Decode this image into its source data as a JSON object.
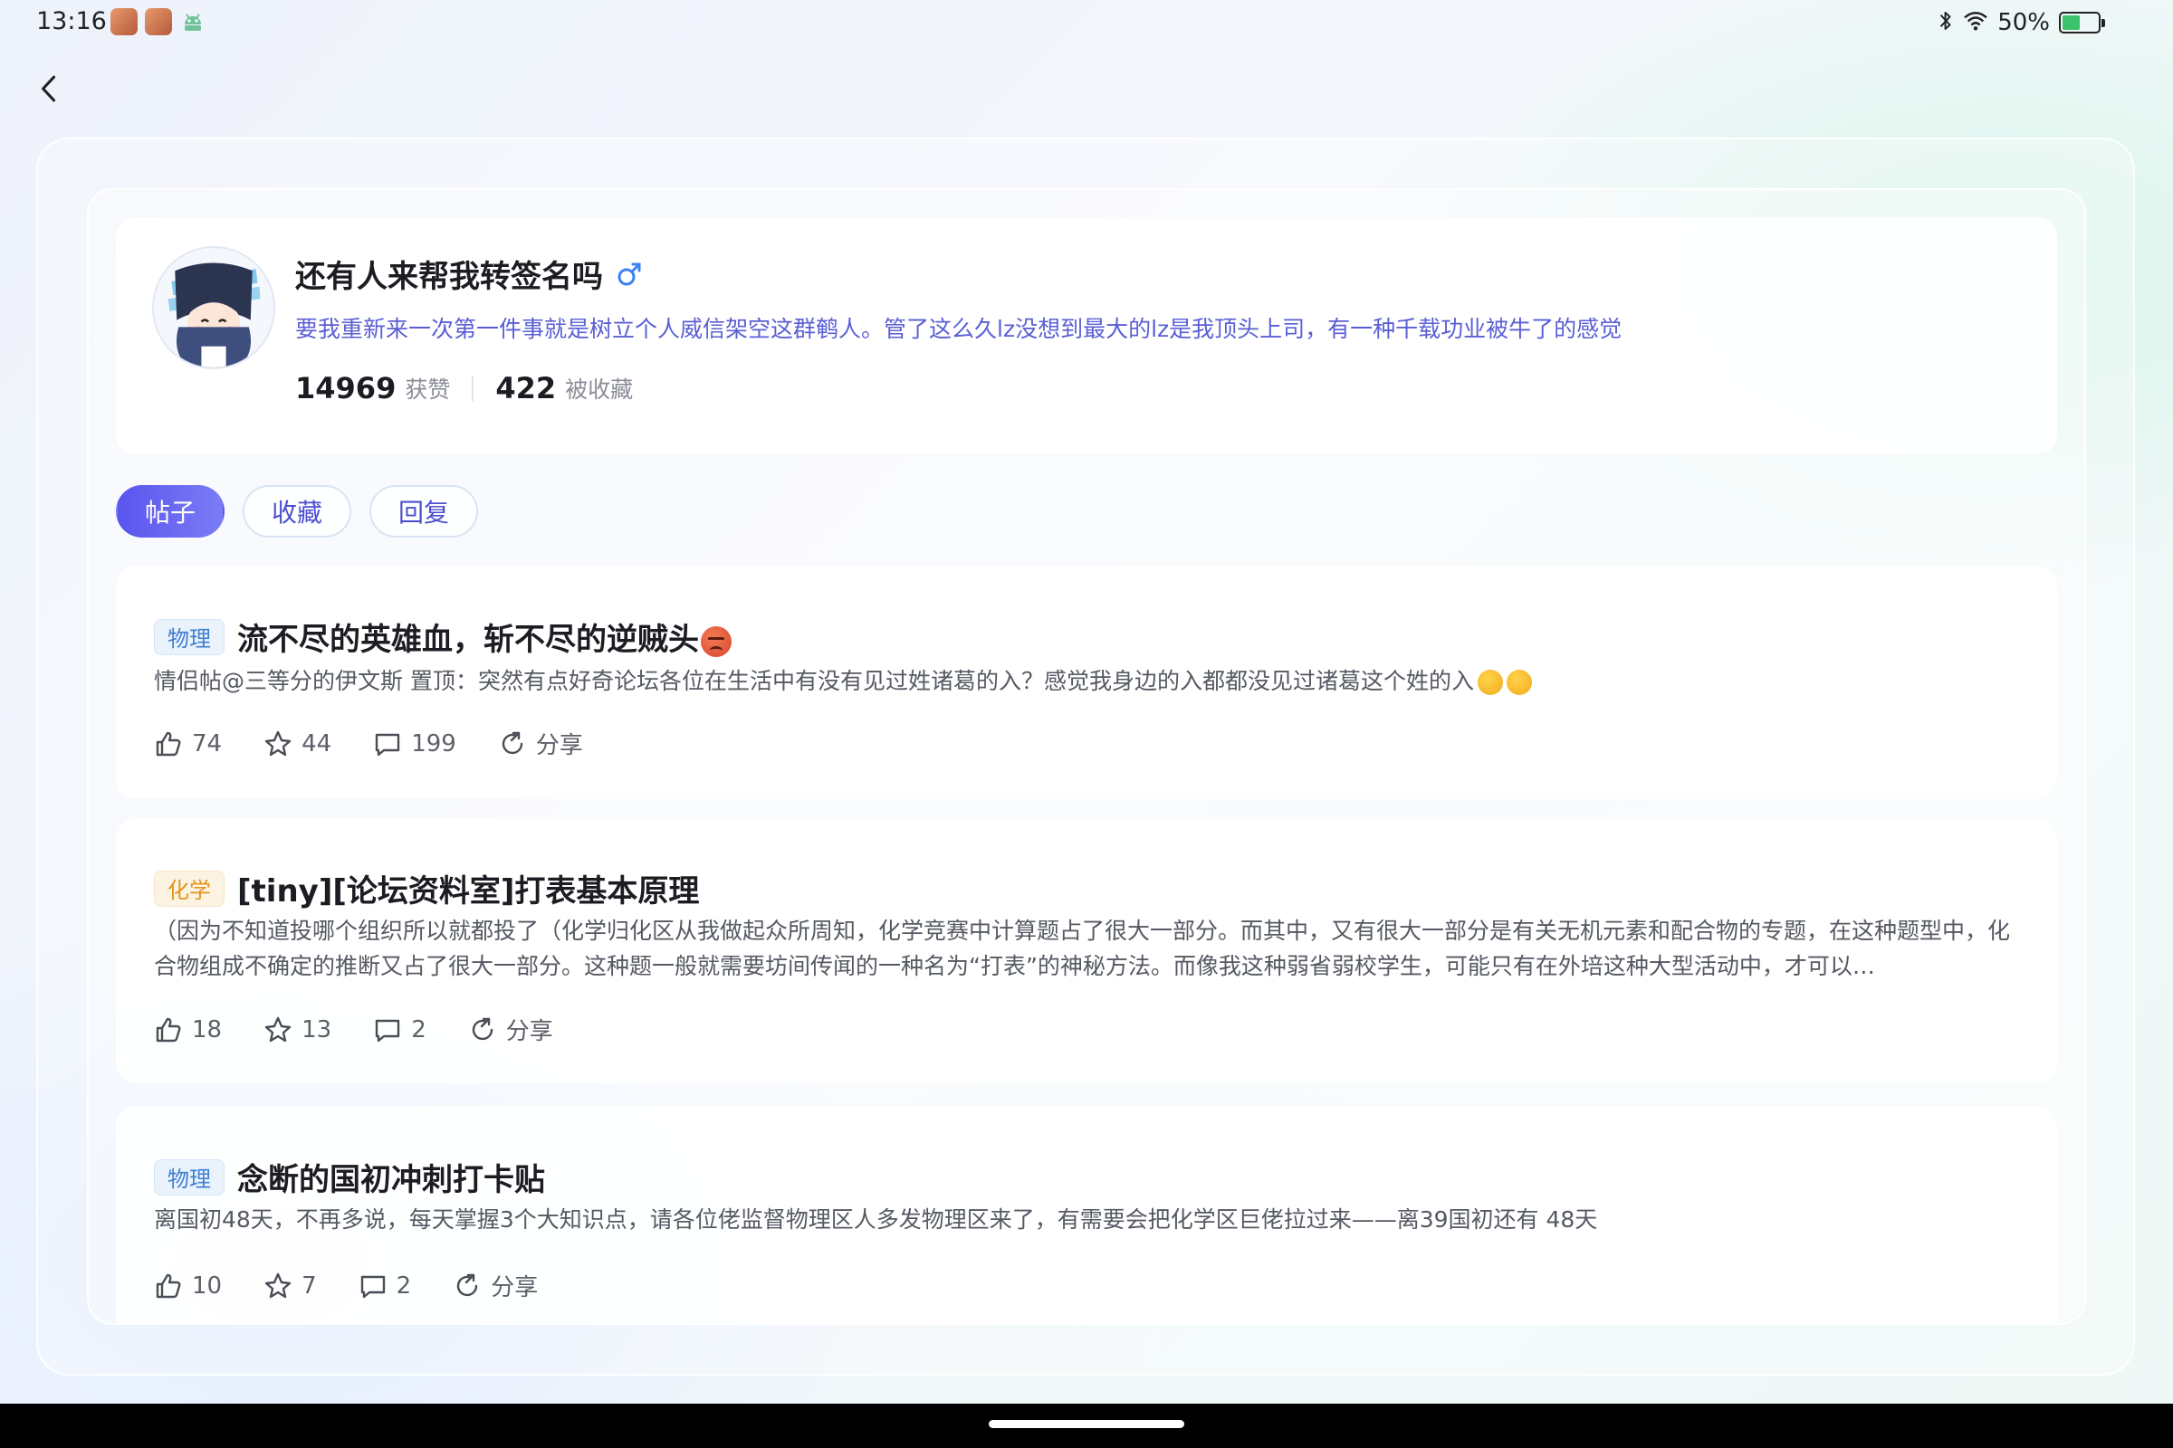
{
  "status_bar": {
    "time": "13:16",
    "battery": "50%",
    "battery_level": 0.5,
    "icons": [
      "bluetooth-icon",
      "wifi-icon",
      "battery-icon"
    ]
  },
  "profile": {
    "name": "还有人来帮我转签名吗",
    "gender_symbol": "♂",
    "gender_color": "#3b82f6",
    "bio": "要我重新来一次第一件事就是树立个人威信架空这群鹌人。管了这么久lz没想到最大的lz是我顶头上司，有一种千载功业被牛了的感觉",
    "likes_count": "14969",
    "likes_label": "获赞",
    "collected_count": "422",
    "collected_label": "被收藏"
  },
  "tabs": [
    {
      "label": "帖子",
      "active": true
    },
    {
      "label": "收藏",
      "active": false
    },
    {
      "label": "回复",
      "active": false
    }
  ],
  "posts": [
    {
      "tag": "物理",
      "title": "流不尽的英雄血，斩不尽的逆贼头",
      "excerpt": "情侣帖@三等分的伊文斯 置顶：突然有点好奇论坛各位在生活中有没有见过姓诸葛的入？感觉我身边的入都都没见过诸葛这个姓的入",
      "likes": "74",
      "stars": "44",
      "comments": "199",
      "share": "分享"
    },
    {
      "tag": "化学",
      "title": "[tiny][论坛资料室]打表基本原理",
      "excerpt": "（因为不知道投哪个组织所以就都投了（化学归化区从我做起众所周知，化学竞赛中计算题占了很大一部分。而其中，又有很大一部分是有关无机元素和配合物的专题，在这种题型中，化合物组成不确定的推断又占了很大一部分。这种题一般就需要坊间传闻的一种名为“打表”的神秘方法。而像我这种弱省弱校学生，可能只有在外培这种大型活动中，才可以…",
      "likes": "18",
      "stars": "13",
      "comments": "2",
      "share": "分享"
    },
    {
      "tag": "物理",
      "title": "念断的国初冲刺打卡贴",
      "excerpt": "离国初48天，不再多说，每天掌握3个大知识点，请各位佬监督物理区人多发物理区来了，有需要会把化学区巨佬拉过来——离39国初还有 48天",
      "likes": "10",
      "stars": "7",
      "comments": "2",
      "share": "分享"
    }
  ],
  "colors": {
    "accent": "#5a55ee",
    "bio_text": "#5a5fd4",
    "tag_physics": "#3f7fd1",
    "tag_chemistry": "#e3941d"
  }
}
